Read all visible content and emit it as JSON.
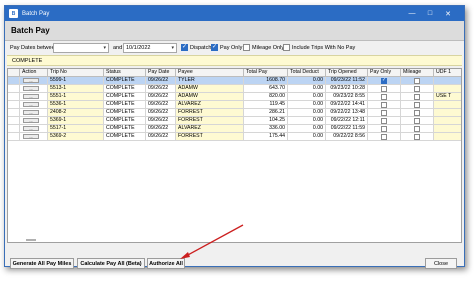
{
  "window": {
    "title": "Batch Pay",
    "icon_text": "B"
  },
  "header": {
    "title": "Batch Pay"
  },
  "filters": {
    "date_label": "Pay Dates between",
    "date_from": "",
    "and_label": "and",
    "date_to": "10/1/2022",
    "dispatch_label": "Dispatch",
    "dispatch_checked": true,
    "pay_only_label": "Pay Only",
    "pay_only_checked": true,
    "mileage_only_label": "Mileage Only",
    "mileage_only_checked": false,
    "include_trips_label": "Include Trips With No Pay",
    "include_trips_checked": false
  },
  "status_strip": {
    "text": "COMPLETE"
  },
  "grid": {
    "columns": [
      "Action",
      "Trip No",
      "Status",
      "Pay Date",
      "Payee",
      "Total Pay",
      "Total Deduct",
      "Trip Opened",
      "Pay Only",
      "Mileage",
      "UDF 1"
    ],
    "action_label": "...",
    "rows": [
      {
        "trip_no": "5599-1",
        "status": "COMPLETE",
        "pay_date": "09/26/22",
        "payee": "TYLER",
        "total_pay": "1608.70",
        "total_deduct": "0.00",
        "trip_opened": "09/23/22 11:52",
        "pay_only": true,
        "mileage": false,
        "udf1": "",
        "selected": true
      },
      {
        "trip_no": "5513-1",
        "status": "COMPLETE",
        "pay_date": "09/26/22",
        "payee": "ADAMW",
        "total_pay": "643.70",
        "total_deduct": "0.00",
        "trip_opened": "09/23/22 10:28",
        "pay_only": false,
        "mileage": false,
        "udf1": "",
        "selected": false
      },
      {
        "trip_no": "5551-1",
        "status": "COMPLETE",
        "pay_date": "09/26/22",
        "payee": "ADAMW",
        "total_pay": "820.00",
        "total_deduct": "0.00",
        "trip_opened": "09/23/22 8:55",
        "pay_only": false,
        "mileage": false,
        "udf1": "USE T",
        "selected": false
      },
      {
        "trip_no": "5536-1",
        "status": "COMPLETE",
        "pay_date": "09/26/22",
        "payee": "ALVAREZ",
        "total_pay": "119.45",
        "total_deduct": "0.00",
        "trip_opened": "09/22/22 14:41",
        "pay_only": false,
        "mileage": false,
        "udf1": "",
        "selected": false
      },
      {
        "trip_no": "2408-2",
        "status": "COMPLETE",
        "pay_date": "09/26/22",
        "payee": "FORREST",
        "total_pay": "286.21",
        "total_deduct": "0.00",
        "trip_opened": "09/22/22 13:48",
        "pay_only": false,
        "mileage": false,
        "udf1": "",
        "selected": false
      },
      {
        "trip_no": "5369-1",
        "status": "COMPLETE",
        "pay_date": "09/26/22",
        "payee": "FORREST",
        "total_pay": "104.25",
        "total_deduct": "0.00",
        "trip_opened": "09/22/22 12:11",
        "pay_only": false,
        "mileage": false,
        "udf1": "",
        "selected": false
      },
      {
        "trip_no": "5517-1",
        "status": "COMPLETE",
        "pay_date": "09/26/22",
        "payee": "ALVAREZ",
        "total_pay": "336.00",
        "total_deduct": "0.00",
        "trip_opened": "09/22/22 11:59",
        "pay_only": false,
        "mileage": false,
        "udf1": "",
        "selected": false
      },
      {
        "trip_no": "5369-2",
        "status": "COMPLETE",
        "pay_date": "09/26/22",
        "payee": "FORREST",
        "total_pay": "175.44",
        "total_deduct": "0.00",
        "trip_opened": "09/22/22 8:56",
        "pay_only": false,
        "mileage": false,
        "udf1": "",
        "selected": false
      }
    ]
  },
  "buttons": {
    "generate": "Generate All Pay Miles",
    "calculate": "Calculate Pay All (Beta)",
    "authorize": "Authorize All",
    "close": "Close"
  },
  "colors": {
    "titlebar": "#2b6cc4",
    "highlight": "#fefad2",
    "selected_row": "#bcd4f3",
    "arrow": "#cc1f1f"
  }
}
